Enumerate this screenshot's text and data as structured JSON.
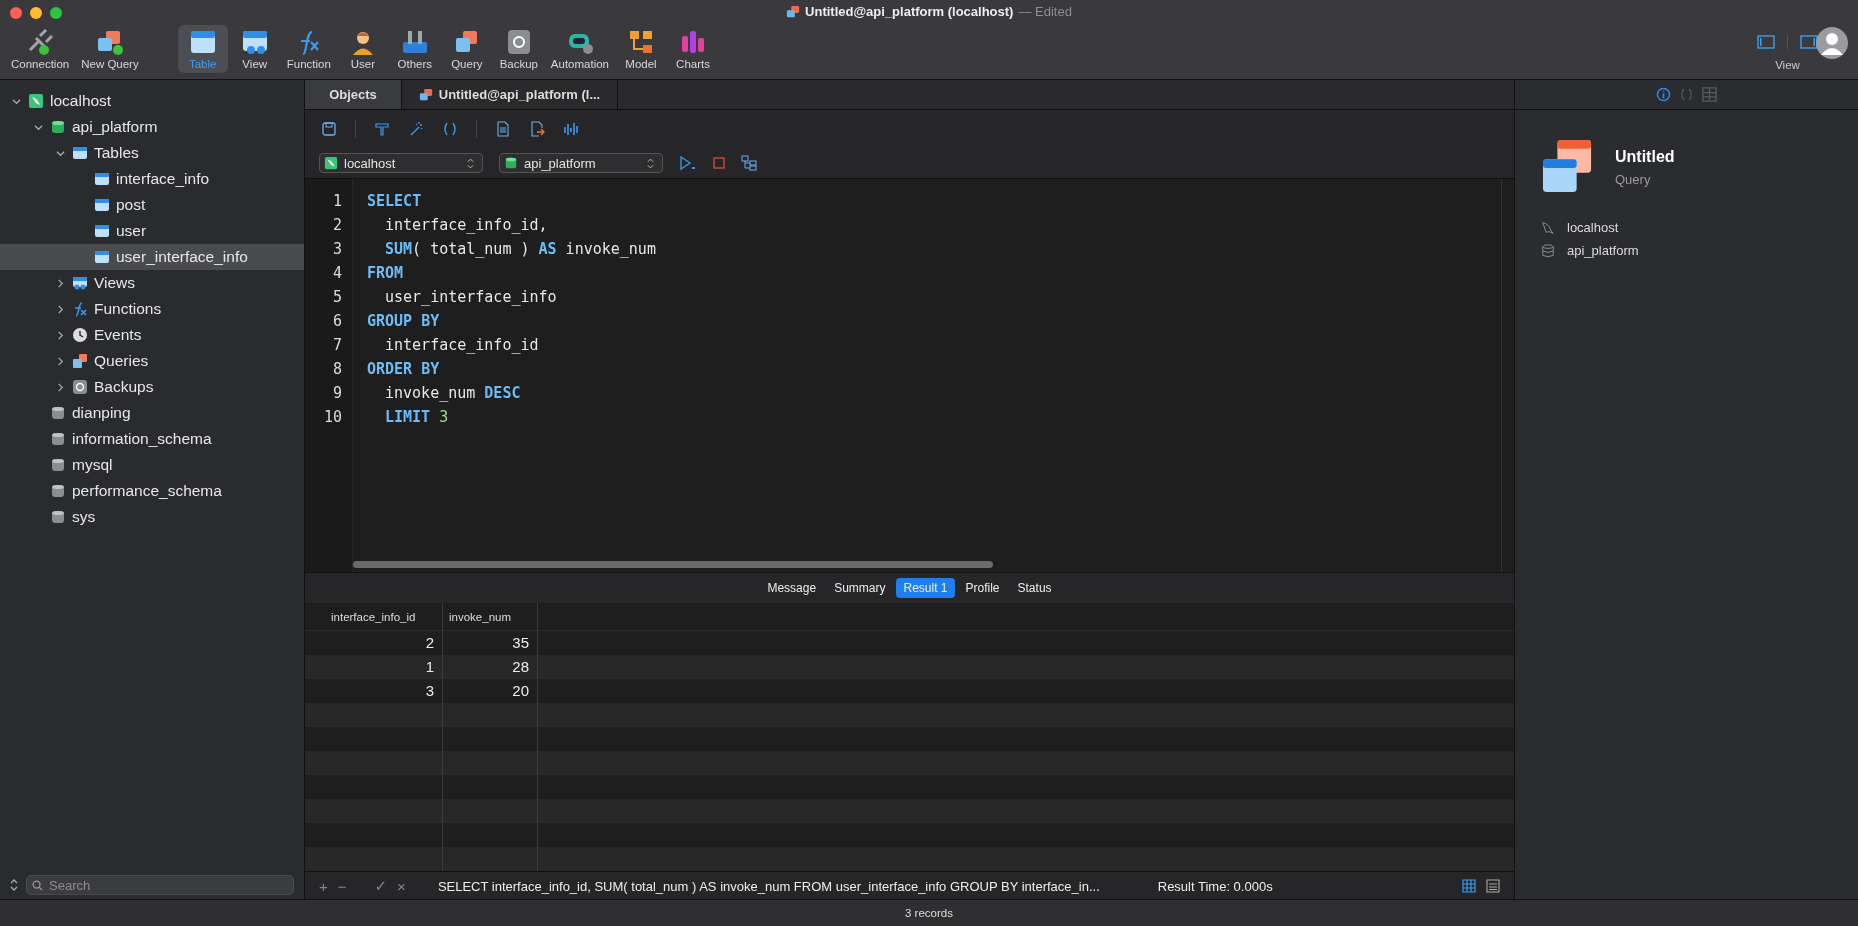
{
  "window": {
    "title": "Untitled@api_platform (localhost)",
    "suffix": "— Edited"
  },
  "toolbar": [
    {
      "label": "Connection",
      "kind": "connection",
      "selected": false
    },
    {
      "label": "New Query",
      "kind": "newquery",
      "selected": false
    },
    {
      "label": "Table",
      "kind": "table",
      "selected": true
    },
    {
      "label": "View",
      "kind": "view",
      "selected": false
    },
    {
      "label": "Function",
      "kind": "function",
      "selected": false
    },
    {
      "label": "User",
      "kind": "user",
      "selected": false
    },
    {
      "label": "Others",
      "kind": "others",
      "selected": false
    },
    {
      "label": "Query",
      "kind": "query",
      "selected": false
    },
    {
      "label": "Backup",
      "kind": "backup",
      "selected": false
    },
    {
      "label": "Automation",
      "kind": "automation",
      "selected": false
    },
    {
      "label": "Model",
      "kind": "model",
      "selected": false
    },
    {
      "label": "Charts",
      "kind": "charts",
      "selected": false
    }
  ],
  "view_group": {
    "label": "View"
  },
  "sidebar": {
    "items": [
      {
        "label": "localhost",
        "kind": "server",
        "expanded": true,
        "selected": false,
        "children": [
          {
            "label": "api_platform",
            "kind": "database",
            "active": true,
            "expanded": true,
            "selected": false,
            "children": [
              {
                "label": "Tables",
                "kind": "tables",
                "expanded": true,
                "selected": false,
                "children": [
                  {
                    "label": "interface_info",
                    "kind": "table",
                    "selected": false
                  },
                  {
                    "label": "post",
                    "kind": "table",
                    "selected": false
                  },
                  {
                    "label": "user",
                    "kind": "table",
                    "selected": false
                  },
                  {
                    "label": "user_interface_info",
                    "kind": "table",
                    "selected": true
                  }
                ]
              },
              {
                "label": "Views",
                "kind": "views",
                "expanded": false,
                "selected": false
              },
              {
                "label": "Functions",
                "kind": "functions",
                "expanded": false,
                "selected": false
              },
              {
                "label": "Events",
                "kind": "events",
                "expanded": false,
                "selected": false
              },
              {
                "label": "Queries",
                "kind": "queries",
                "expanded": false,
                "selected": false
              },
              {
                "label": "Backups",
                "kind": "backups",
                "expanded": false,
                "selected": false
              }
            ]
          },
          {
            "label": "dianping",
            "kind": "database",
            "active": false,
            "selected": false
          },
          {
            "label": "information_schema",
            "kind": "database",
            "active": false,
            "selected": false
          },
          {
            "label": "mysql",
            "kind": "database",
            "active": false,
            "selected": false
          },
          {
            "label": "performance_schema",
            "kind": "database",
            "active": false,
            "selected": false
          },
          {
            "label": "sys",
            "kind": "database",
            "active": false,
            "selected": false
          }
        ]
      }
    ],
    "search": {
      "placeholder": "Search"
    }
  },
  "tabs": [
    {
      "label": "Objects",
      "selected": false
    },
    {
      "label": "Untitled@api_platform (l...",
      "selected": true
    }
  ],
  "selectors": {
    "connection": "localhost",
    "database": "api_platform"
  },
  "code": [
    {
      "indented": false,
      "tokens": [
        {
          "text": "SELECT",
          "kind": "keyword"
        }
      ]
    },
    {
      "indented": true,
      "tokens": [
        {
          "text": "interface_info_id,",
          "kind": "plain"
        }
      ]
    },
    {
      "indented": true,
      "tokens": [
        {
          "text": "SUM",
          "kind": "function"
        },
        {
          "text": "( total_num ) ",
          "kind": "plain"
        },
        {
          "text": "AS",
          "kind": "keyword"
        },
        {
          "text": " invoke_num",
          "kind": "plain"
        }
      ]
    },
    {
      "indented": false,
      "tokens": [
        {
          "text": "FROM",
          "kind": "keyword"
        }
      ]
    },
    {
      "indented": true,
      "tokens": [
        {
          "text": "user_interface_info",
          "kind": "plain"
        }
      ]
    },
    {
      "indented": false,
      "tokens": [
        {
          "text": "GROUP BY",
          "kind": "keyword"
        }
      ]
    },
    {
      "indented": true,
      "tokens": [
        {
          "text": "interface_info_id",
          "kind": "plain"
        }
      ]
    },
    {
      "indented": false,
      "tokens": [
        {
          "text": "ORDER BY",
          "kind": "keyword"
        }
      ]
    },
    {
      "indented": true,
      "tokens": [
        {
          "text": "invoke_num ",
          "kind": "plain"
        },
        {
          "text": "DESC",
          "kind": "keyword"
        }
      ]
    },
    {
      "indented": true,
      "tokens": [
        {
          "text": "LIMIT ",
          "kind": "keyword"
        },
        {
          "text": "3",
          "kind": "number"
        }
      ]
    }
  ],
  "line_numbers": [
    "1",
    "2",
    "3",
    "4",
    "5",
    "6",
    "7",
    "8",
    "9",
    "10"
  ],
  "result_tabs": [
    {
      "label": "Message",
      "selected": false
    },
    {
      "label": "Summary",
      "selected": false
    },
    {
      "label": "Result 1",
      "selected": true
    },
    {
      "label": "Profile",
      "selected": false
    },
    {
      "label": "Status",
      "selected": false
    }
  ],
  "table": {
    "columns": [
      "interface_info_id",
      "invoke_num"
    ],
    "rows": [
      [
        "2",
        "35"
      ],
      [
        "1",
        "28"
      ],
      [
        "3",
        "20"
      ]
    ]
  },
  "footer": {
    "buttons": [
      "+",
      "−",
      "✓",
      "×"
    ],
    "sql": "SELECT  interface_info_id,  SUM( total_num ) AS invoke_num  FROM user_interface_info  GROUP BY interface_in...",
    "time": "Result Time: 0.000s"
  },
  "status_bar": "3 records",
  "inspector": {
    "tabs": [
      {
        "kind": "info",
        "selected": true
      },
      {
        "kind": "code",
        "selected": false
      },
      {
        "kind": "grid",
        "selected": false
      }
    ],
    "title": "Untitled",
    "subtitle": "Query",
    "details": [
      {
        "kind": "server",
        "text": "localhost"
      },
      {
        "kind": "database",
        "text": "api_platform"
      }
    ]
  }
}
